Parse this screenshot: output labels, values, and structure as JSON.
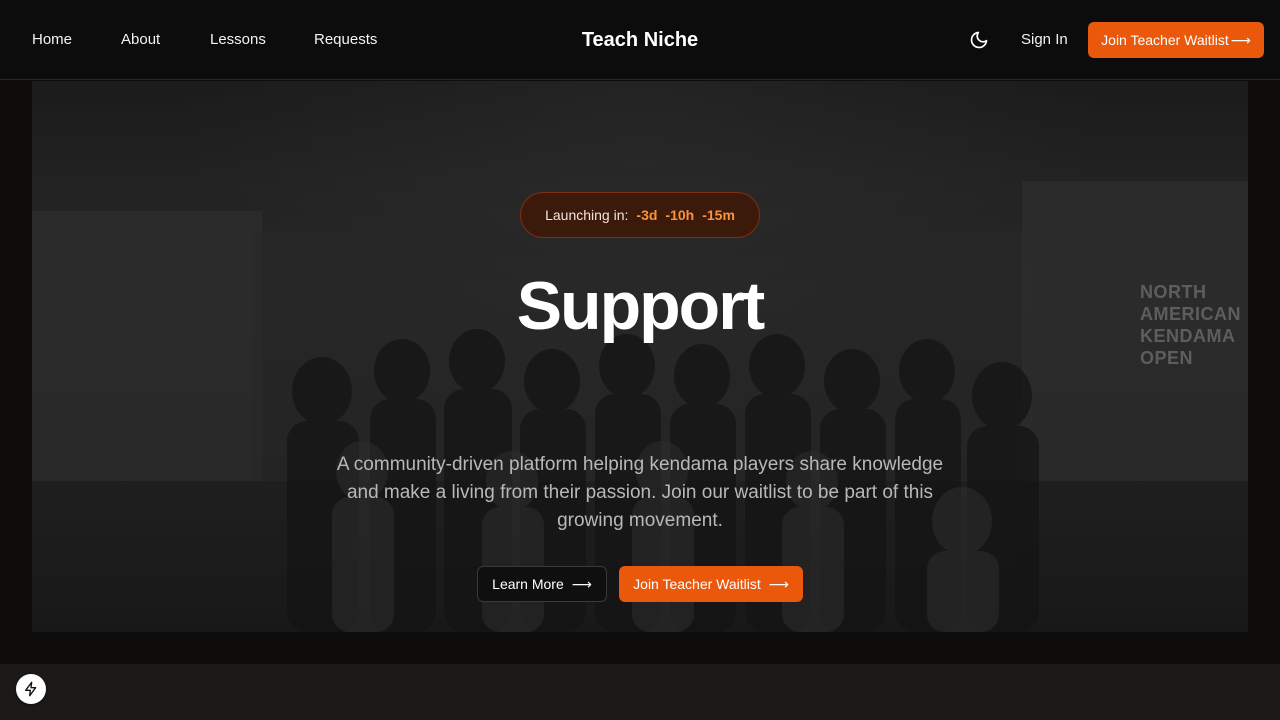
{
  "nav": {
    "links": [
      {
        "label": "Home"
      },
      {
        "label": "About"
      },
      {
        "label": "Lessons"
      },
      {
        "label": "Requests"
      }
    ],
    "brand": "Teach Niche",
    "theme_toggle_icon": "moon-icon",
    "sign_in": "Sign In",
    "cta": "Join Teacher Waitlist",
    "cta_arrow": "⟶"
  },
  "hero": {
    "countdown": {
      "label": "Launching in:",
      "days": "-3d",
      "hours": "-10h",
      "minutes": "-15m"
    },
    "title": "Support",
    "description": "A community-driven platform helping kendama players share knowledge and make a living from their passion. Join our waitlist to be part of this growing movement.",
    "learn_more": "Learn More",
    "join_waitlist": "Join Teacher Waitlist",
    "arrow": "⟶",
    "background_banner_text": "NORTH AMERICAN KENDAMA OPEN"
  },
  "dev_tool_icon": "lightning-icon",
  "colors": {
    "accent": "#ea580c",
    "countdown_text": "#fb923c",
    "nav_bg": "#0c0c0c",
    "page_bg": "#0e0d0c"
  }
}
